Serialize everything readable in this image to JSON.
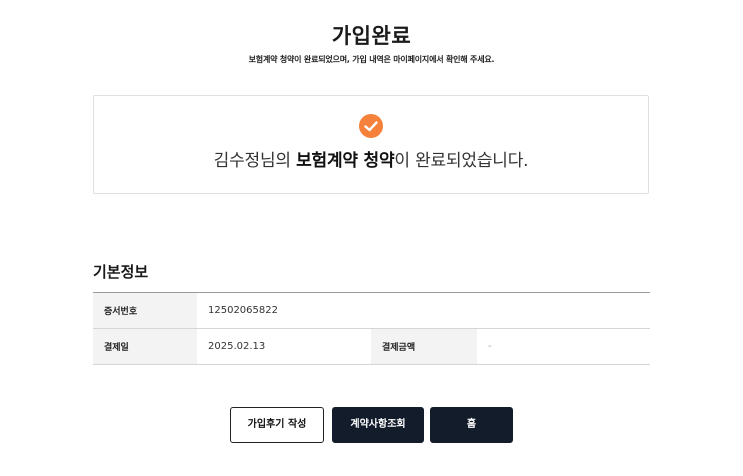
{
  "header": {
    "title": "가입완료",
    "subtitle": "보험계약 청약이 완료되었으며, 가입 내역은 마이페이지에서 확인해 주세요."
  },
  "completion": {
    "name": "김수정",
    "name_suffix": "님의 ",
    "emphasis": "보험계약 청약",
    "tail": "이 완료되었습니다.",
    "accent_color": "#f5813b",
    "icon": "check-circle-icon"
  },
  "basic_info": {
    "title": "기본정보",
    "rows": [
      {
        "label": "증서번호",
        "value": "12502065822"
      },
      {
        "label": "결제일",
        "value": "2025.02.13",
        "label2": "결제금액",
        "value2": "-"
      }
    ]
  },
  "buttons": {
    "review": "가입후기 작성",
    "contract_inquiry": "계약사항조회",
    "home": "홈",
    "dark_color": "#131c2b"
  }
}
